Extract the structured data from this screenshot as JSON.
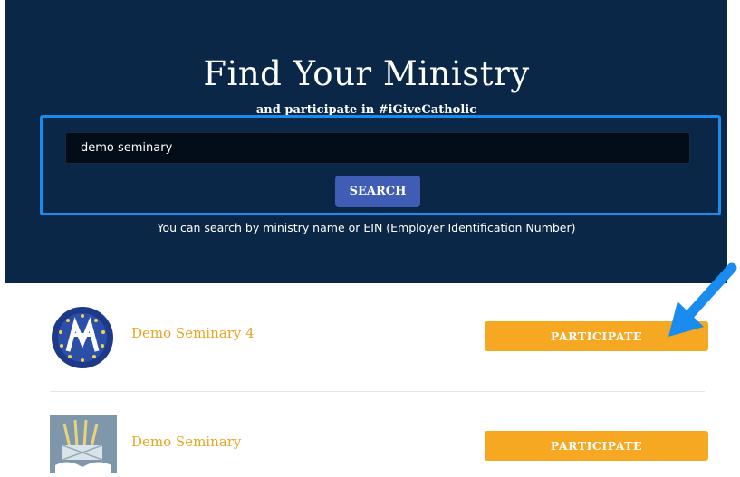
{
  "hero": {
    "title": "Find Your Ministry",
    "subtitle": "and participate in #iGiveCatholic",
    "search_value": "demo seminary",
    "search_button": "SEARCH",
    "hint": "You can search by ministry name or EIN (Employer Identification Number)"
  },
  "results": [
    {
      "name": "Demo Seminary 4",
      "button": "PARTICIPATE",
      "logo": "seal-logo-icon"
    },
    {
      "name": "Demo Seminary",
      "button": "PARTICIPATE",
      "logo": "wheat-basket-logo-icon"
    }
  ],
  "colors": {
    "hero_bg": "#0b2747",
    "highlight": "#1a8cf0",
    "search_button": "#3f5db4",
    "accent": "#f6a823",
    "ministry_name": "#e8a425"
  }
}
